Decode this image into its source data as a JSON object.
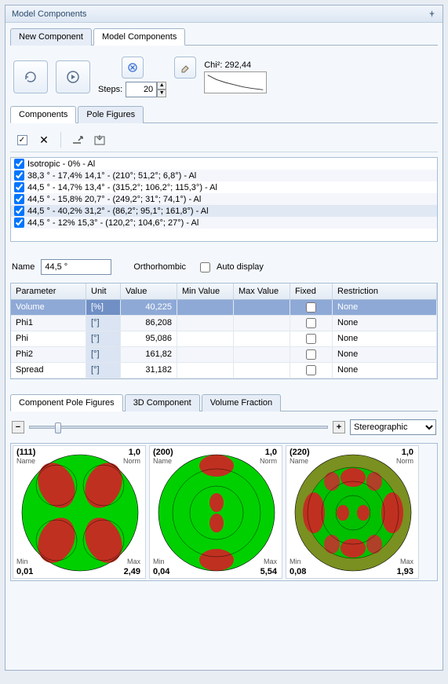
{
  "panel": {
    "title": "Model Components"
  },
  "tabs_top": {
    "new_component": "New Component",
    "model_components": "Model Components"
  },
  "toolbar": {
    "steps_label": "Steps:",
    "steps_value": "20",
    "chi_label": "Chi²: 292,44"
  },
  "tabs_mid": {
    "components": "Components",
    "pole_figures": "Pole Figures"
  },
  "component_list": [
    "Isotropic - 0% - Al",
    "38,3 ° - 17,4% 14,1° - (210°; 51,2°; 6,8°) - Al",
    "44,5 ° - 14,7% 13,4° - (315,2°; 106,2°; 115,3°) - Al",
    "44,5 ° - 15,8% 20,7° - (249,2°; 31°; 74,1°) - Al",
    "44,5 ° - 40,2% 31,2° - (86,2°; 95,1°; 161,8°) - Al",
    "44,5 ° - 12% 15,3° - (120,2°; 104,6°; 27°) - Al"
  ],
  "name_row": {
    "name_label": "Name",
    "name_value": "44,5 °",
    "orth": "Orthorhombic",
    "auto": "Auto display"
  },
  "grid": {
    "headers": [
      "Parameter",
      "Unit",
      "Value",
      "Min Value",
      "Max Value",
      "Fixed",
      "Restriction"
    ],
    "rows": [
      {
        "param": "Volume",
        "unit": "[%]",
        "value": "40,225",
        "restr": "None",
        "sel": true
      },
      {
        "param": "Phi1",
        "unit": "[°]",
        "value": "86,208",
        "restr": "None"
      },
      {
        "param": "Phi",
        "unit": "[°]",
        "value": "95,086",
        "restr": "None"
      },
      {
        "param": "Phi2",
        "unit": "[°]",
        "value": "161,82",
        "restr": "None"
      },
      {
        "param": "Spread",
        "unit": "[°]",
        "value": "31,182",
        "restr": "None"
      }
    ]
  },
  "tabs_bot": {
    "cpf": "Component Pole Figures",
    "c3d": "3D Component",
    "vf": "Volume Fraction"
  },
  "projection": {
    "value": "Stereographic"
  },
  "pole_figures": [
    {
      "hkl": "(111)",
      "min": "0,01",
      "max": "2,49",
      "norm": "1,0"
    },
    {
      "hkl": "(200)",
      "min": "0,04",
      "max": "5,54",
      "norm": "1,0"
    },
    {
      "hkl": "(220)",
      "min": "0,08",
      "max": "1,93",
      "norm": "1,0"
    }
  ],
  "labels": {
    "name_tl": "Name",
    "norm": "Norm",
    "min": "Min",
    "max": "Max"
  }
}
